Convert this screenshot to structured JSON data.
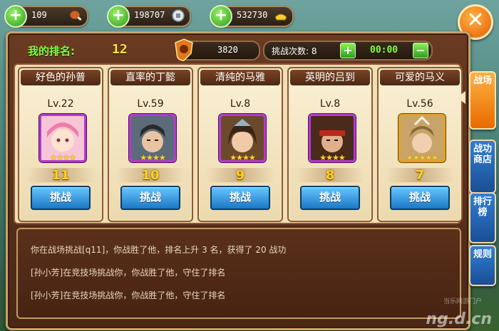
{
  "resources": [
    {
      "value": "109",
      "icon": "drumstick-icon"
    },
    {
      "value": "198707",
      "icon": "silver-coin-icon"
    },
    {
      "value": "532730",
      "icon": "gold-ingot-icon"
    }
  ],
  "header": {
    "rank_label": "我的排名:",
    "rank_value": "12",
    "score": "3820",
    "challenge_label": "挑战次数: 8",
    "timer": "00:00"
  },
  "opponents": [
    {
      "name": "好色的孙普",
      "level": "Lv.22",
      "rank": "11",
      "frame": "purple",
      "stars": "★★★★",
      "button": "挑战"
    },
    {
      "name": "直率的丁懿",
      "level": "Lv.59",
      "rank": "10",
      "frame": "purple",
      "stars": "★★★★",
      "button": "挑战"
    },
    {
      "name": "清纯的马雅",
      "level": "Lv.8",
      "rank": "9",
      "frame": "purple",
      "stars": "★★★★",
      "button": "挑战"
    },
    {
      "name": "英明的吕到",
      "level": "Lv.8",
      "rank": "8",
      "frame": "purple",
      "stars": "★★★★",
      "button": "挑战"
    },
    {
      "name": "可爱的马义",
      "level": "Lv.56",
      "rank": "7",
      "frame": "gold",
      "stars": "★★★★★",
      "button": "挑战"
    }
  ],
  "log": [
    "你在战场挑战[q11]，你战胜了他，排名上升 3 名，获得了 20 战功",
    "[孙小芳]在竞技场挑战你，你战胜了他，守住了排名",
    "[孙小芳]在竞技场挑战你，你战胜了他，守住了排名"
  ],
  "side_tabs": [
    {
      "label": "战场",
      "active": true
    },
    {
      "label": "战功商店",
      "active": false
    },
    {
      "label": "排行榜",
      "active": false
    },
    {
      "label": "规则",
      "active": false
    }
  ],
  "watermark": {
    "main": "ng.d.cn",
    "sub": "当乐网游门户"
  },
  "colors": {
    "accent_green": "#7eff3e",
    "accent_yellow": "#ffd31a",
    "button_blue": "#1b78c4"
  }
}
